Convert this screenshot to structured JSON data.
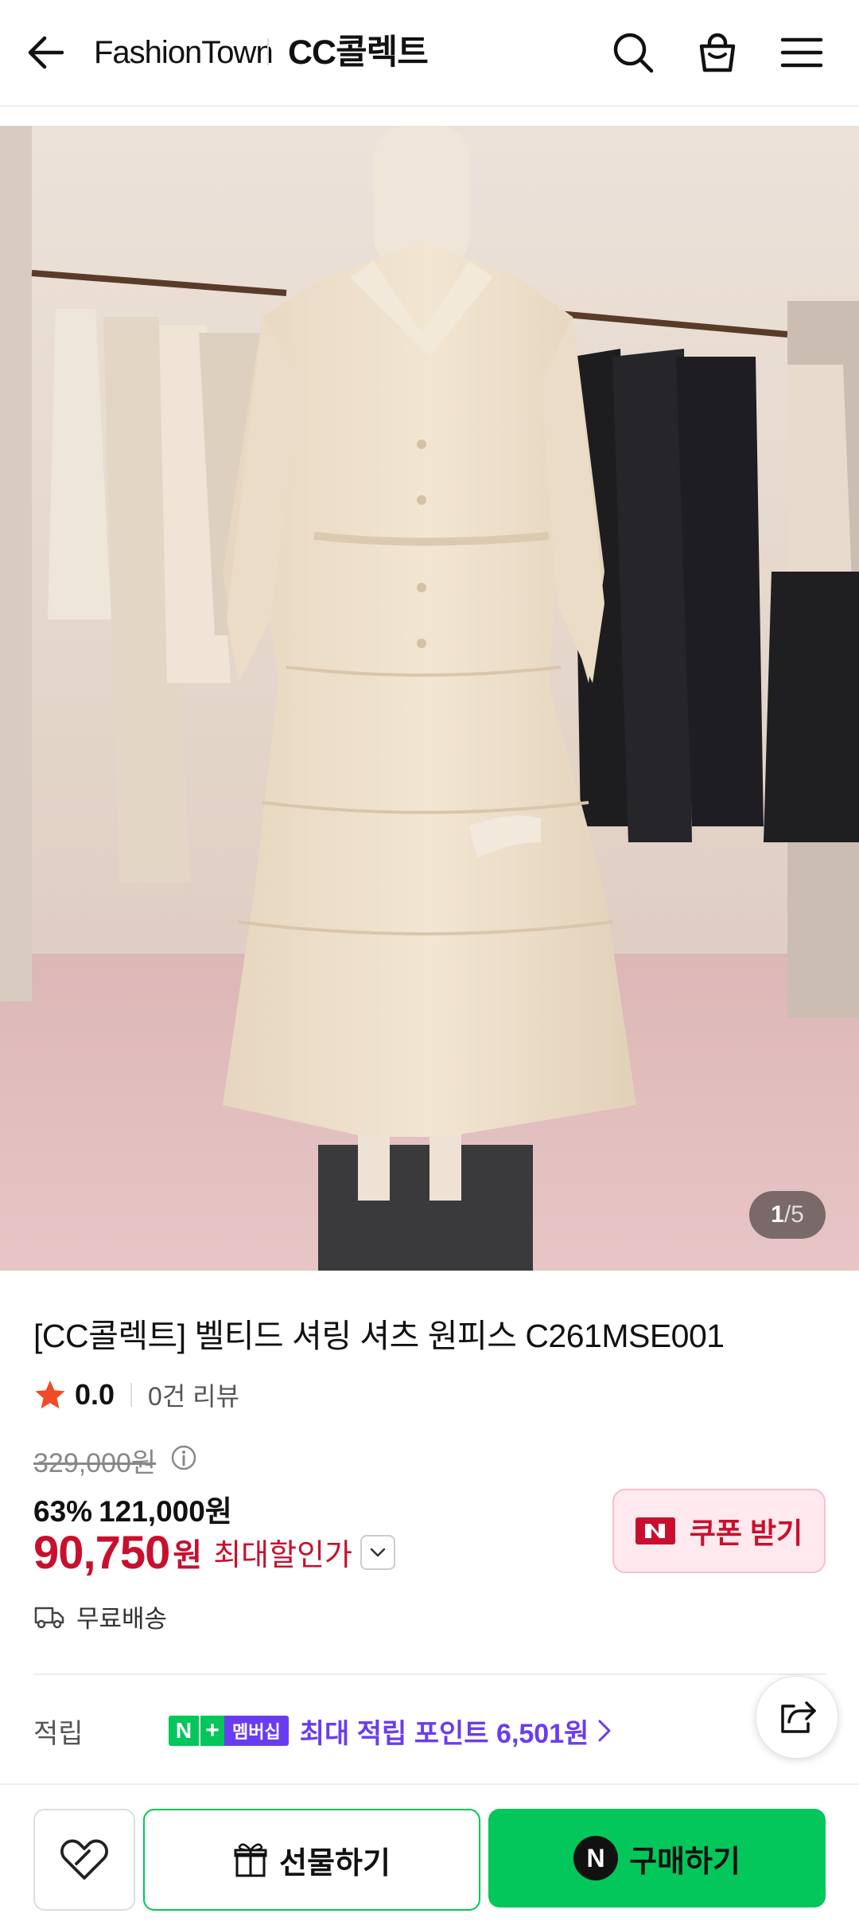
{
  "header": {
    "brand": "FashionTown",
    "store": "CC콜렉트"
  },
  "image": {
    "current": "1",
    "separator": " / ",
    "total": "5"
  },
  "product": {
    "title": "[CC콜렉트] 벨티드 셔링 셔츠 원피스 C261MSE001",
    "rating": "0.0",
    "reviews": "0건 리뷰",
    "original_price": "329,000원",
    "discount_rate": "63%",
    "sale_price": "121,000원",
    "final_price": "90,750",
    "final_currency": "원",
    "max_discount_label": "최대할인가"
  },
  "coupon": {
    "label": "쿠폰 받기"
  },
  "shipping": {
    "label": "무료배송"
  },
  "points": {
    "label": "적립",
    "badge_n": "N",
    "badge_plus": "+",
    "badge_membership": "멤버십",
    "text": "최대 적립 포인트 6,501원"
  },
  "bottom_bar": {
    "gift_label": "선물하기",
    "buy_label": "구매하기",
    "buy_icon_letter": "N"
  },
  "colors": {
    "accent_red": "#c8102e",
    "naver_green": "#03c75a",
    "membership_purple": "#6a3cf0"
  }
}
